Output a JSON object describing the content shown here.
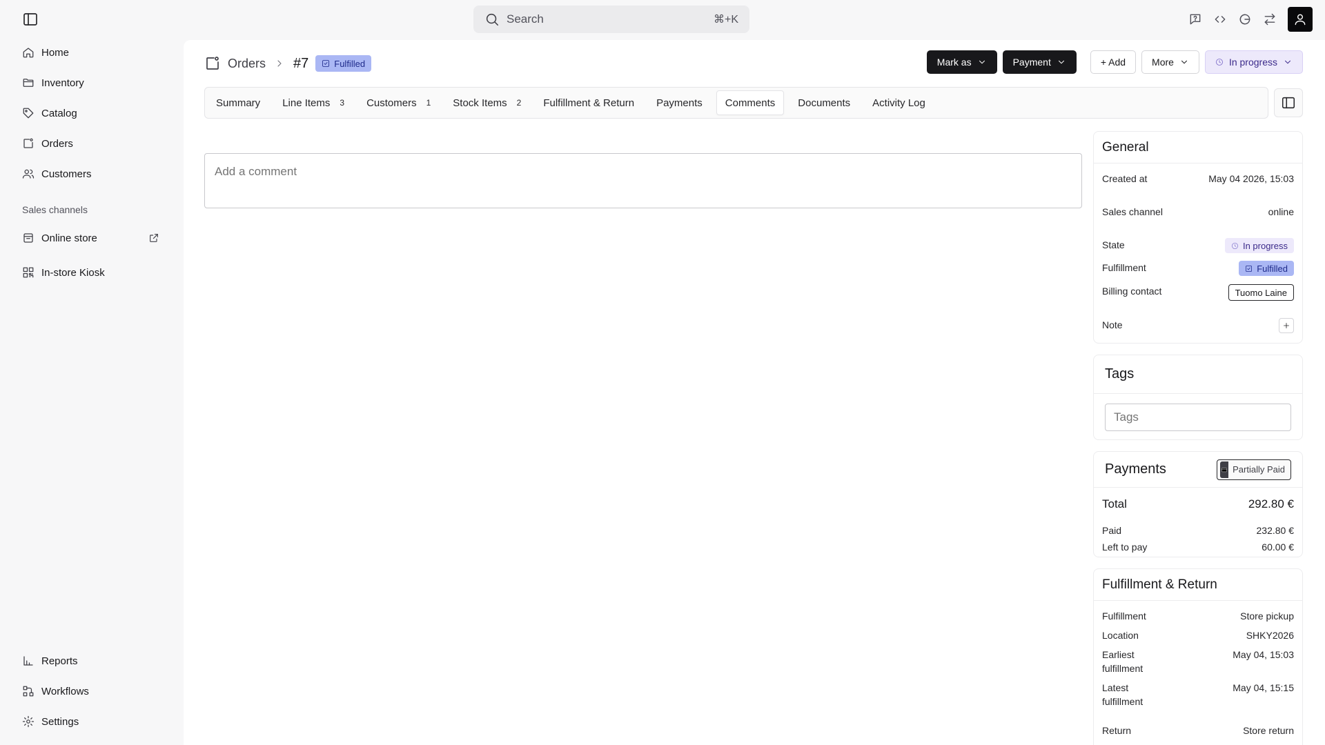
{
  "search": {
    "placeholder": "Search",
    "shortcut": "⌘+K"
  },
  "sidebar": {
    "items": [
      {
        "label": "Home",
        "icon": "home-icon"
      },
      {
        "label": "Inventory",
        "icon": "folder-icon"
      },
      {
        "label": "Catalog",
        "icon": "tag-icon"
      },
      {
        "label": "Orders",
        "icon": "orders-icon"
      },
      {
        "label": "Customers",
        "icon": "users-icon"
      }
    ],
    "section_label": "Sales channels",
    "channels": [
      {
        "label": "Online store",
        "icon": "store-icon"
      },
      {
        "label": "In-store Kiosk",
        "icon": "qr-icon"
      }
    ],
    "bottom": [
      {
        "label": "Reports",
        "icon": "chart-icon"
      },
      {
        "label": "Workflows",
        "icon": "workflow-icon"
      },
      {
        "label": "Settings",
        "icon": "gear-icon"
      }
    ]
  },
  "header": {
    "breadcrumb": "Orders",
    "order_id": "#7",
    "status_badge": "Fulfilled",
    "actions": {
      "mark_as": "Mark as",
      "payment": "Payment",
      "add": "+ Add",
      "more": "More",
      "state": "In progress"
    }
  },
  "tabs": [
    {
      "label": "Summary",
      "count": ""
    },
    {
      "label": "Line Items",
      "count": "3"
    },
    {
      "label": "Customers",
      "count": "1"
    },
    {
      "label": "Stock Items",
      "count": "2"
    },
    {
      "label": "Fulfillment & Return",
      "count": ""
    },
    {
      "label": "Payments",
      "count": ""
    },
    {
      "label": "Comments",
      "count": "",
      "active": true
    },
    {
      "label": "Documents",
      "count": ""
    },
    {
      "label": "Activity Log",
      "count": ""
    }
  ],
  "comment": {
    "placeholder": "Add a comment"
  },
  "general": {
    "title": "General",
    "created_at_label": "Created at",
    "created_at_value": "May 04 2026, 15:03",
    "sales_channel_label": "Sales channel",
    "sales_channel_value": "online",
    "state_label": "State",
    "state_value": "In progress",
    "fulfillment_label": "Fulfillment",
    "fulfillment_value": "Fulfilled",
    "billing_label": "Billing contact",
    "billing_value": "Tuomo Laine",
    "note_label": "Note"
  },
  "tags": {
    "title": "Tags",
    "placeholder": "Tags"
  },
  "payments": {
    "title": "Payments",
    "badge": "Partially Paid",
    "total_label": "Total",
    "total_value": "292.80 €",
    "paid_label": "Paid",
    "paid_value": "232.80 €",
    "left_label": "Left to pay",
    "left_value": "60.00 €"
  },
  "fulfillment_return": {
    "title": "Fulfillment & Return",
    "fulfillment_label": "Fulfillment",
    "fulfillment_value": "Store pickup",
    "location_label": "Location",
    "location_value": "SHKY2026",
    "earliest_label": "Earliest fulfillment",
    "earliest_value": "May 04, 15:03",
    "latest_label": "Latest fulfillment",
    "latest_value": "May 04, 15:15",
    "return_label": "Return",
    "return_value": "Store return"
  },
  "colors": {
    "accent_dark": "#18181b",
    "fulfilled_badge": "#aab7f4",
    "in_progress_badge": "#ede9fb"
  }
}
